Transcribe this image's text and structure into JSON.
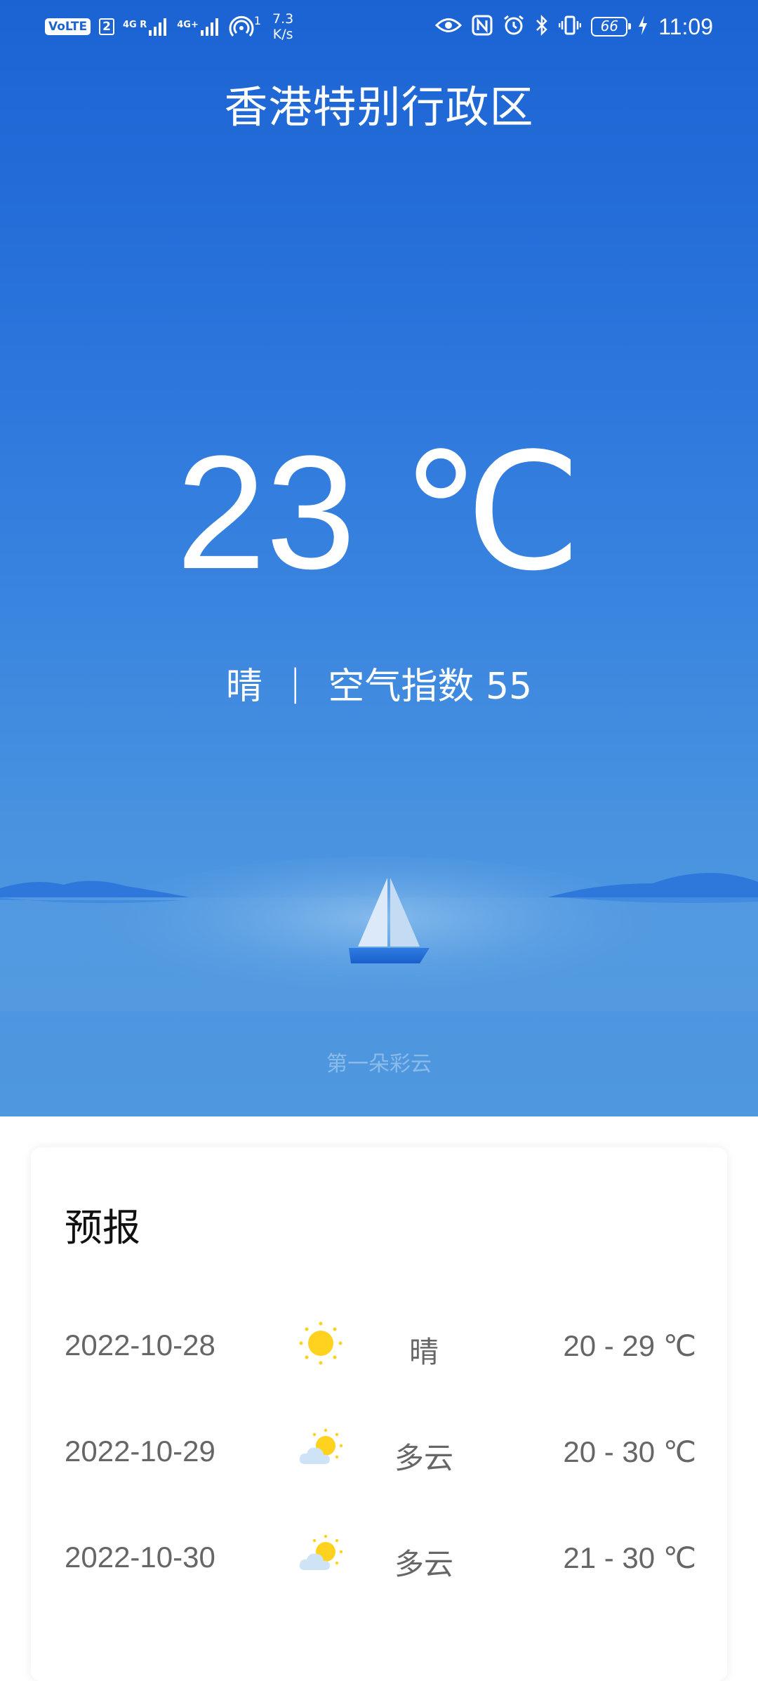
{
  "status_bar": {
    "volte": "VoLTE",
    "sim": "2",
    "net1": "4G R",
    "net2": "4G+",
    "hotspot_count": "1",
    "speed_value": "7.3",
    "speed_unit": "K/s",
    "battery": "66",
    "time": "11:09"
  },
  "current": {
    "city": "香港特别行政区",
    "temperature": "23 ℃",
    "condition": "晴",
    "separator": "|",
    "aqi_text": "空气指数 55"
  },
  "brand": "第一朵彩云",
  "forecast": {
    "title": "预报",
    "days": [
      {
        "date": "2022-10-28",
        "icon": "sun-icon",
        "condition": "晴",
        "range": "20 - 29 ℃"
      },
      {
        "date": "2022-10-29",
        "icon": "partly-cloudy-icon",
        "condition": "多云",
        "range": "20 - 30 ℃"
      },
      {
        "date": "2022-10-30",
        "icon": "partly-cloudy-icon",
        "condition": "多云",
        "range": "21 - 30 ℃"
      }
    ]
  },
  "colors": {
    "sky_top": "#1b63d3",
    "sky_bottom": "#4f98df",
    "sun": "#ffd21f",
    "cloud": "#cfe3f7",
    "text_secondary": "#666666"
  }
}
